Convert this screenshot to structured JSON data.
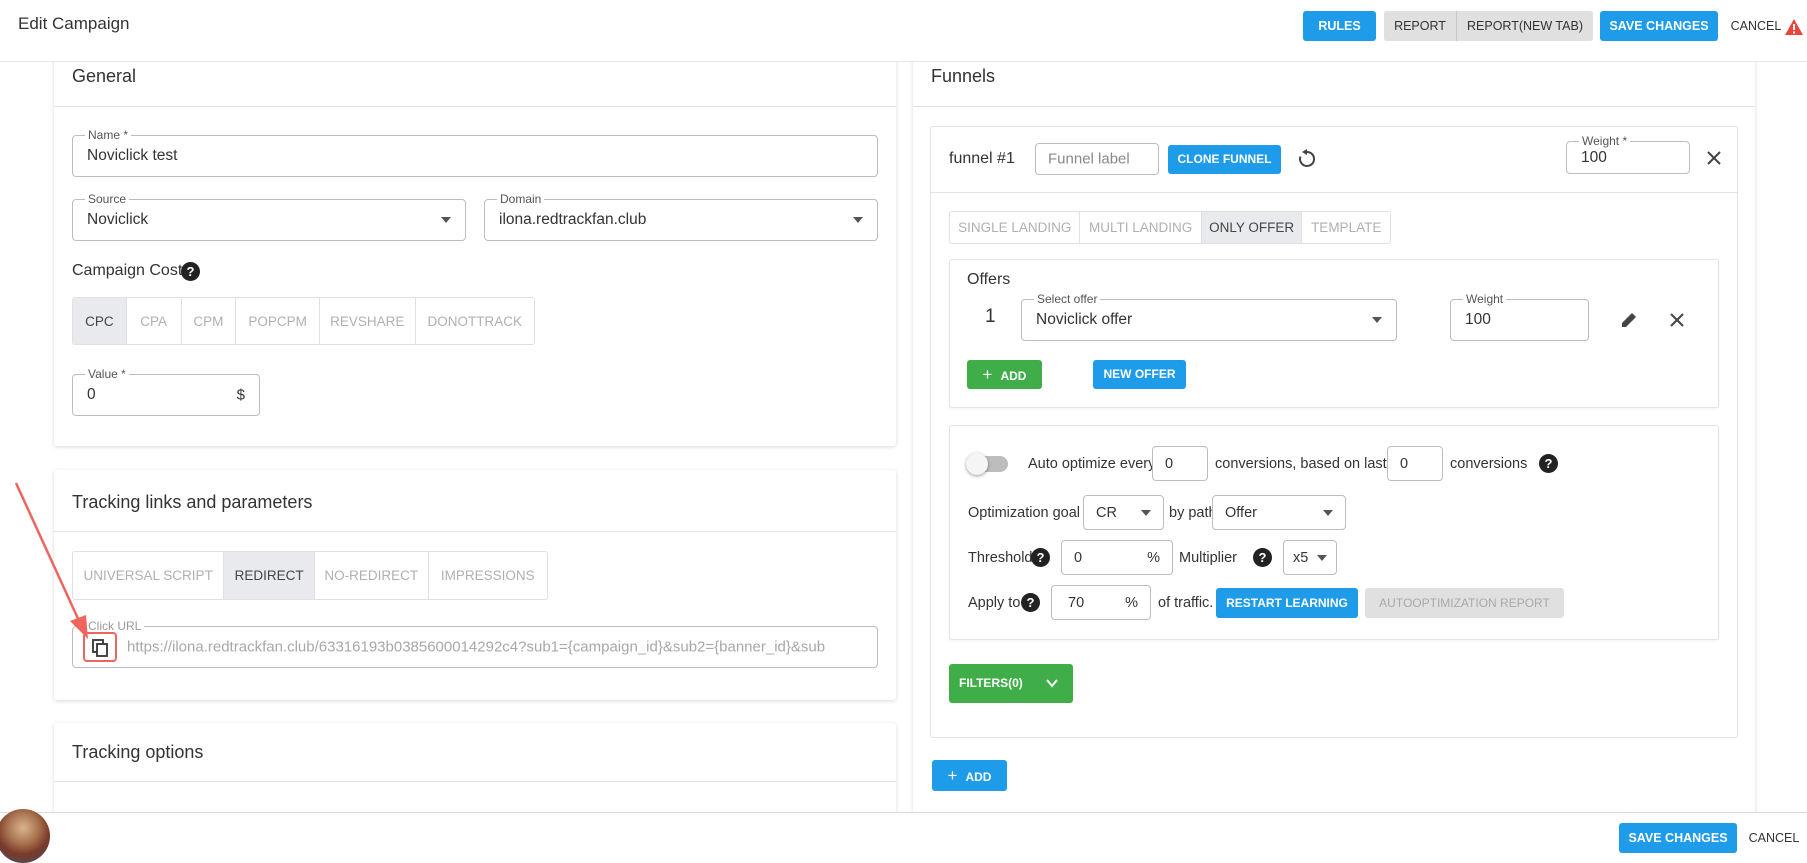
{
  "header": {
    "title": "Edit Campaign",
    "rules_label": "RULES",
    "report_label": "REPORT",
    "report_new_tab_label": "REPORT(NEW TAB)",
    "save_label": "SAVE CHANGES",
    "cancel_label": "CANCEL"
  },
  "general": {
    "title": "General",
    "name_label": "Name *",
    "name_value": "Noviclick test",
    "source_label": "Source",
    "source_value": "Noviclick",
    "domain_label": "Domain",
    "domain_value": "ilona.redtrackfan.club",
    "cost_title": "Campaign Cost",
    "cost_types": [
      "CPC",
      "CPA",
      "CPM",
      "POPCPM",
      "REVSHARE",
      "DONOTTRACK"
    ],
    "cost_selected": "CPC",
    "value_label": "Value *",
    "value_value": "0",
    "value_unit": "$"
  },
  "tracking": {
    "title": "Tracking links and parameters",
    "tabs": [
      "UNIVERSAL SCRIPT",
      "REDIRECT",
      "NO-REDIRECT",
      "IMPRESSIONS"
    ],
    "active_tab": "REDIRECT",
    "click_url_label": "Click URL",
    "click_url_value": "https://ilona.redtrackfan.club/63316193b0385600014292c4?sub1={campaign_id}&sub2={banner_id}&sub"
  },
  "tracking_options": {
    "title": "Tracking options"
  },
  "funnels": {
    "title": "Funnels",
    "funnel_name": "funnel #1",
    "funnel_label_placeholder": "Funnel label",
    "clone_label": "CLONE FUNNEL",
    "weight_label": "Weight *",
    "weight_value": "100",
    "modes": [
      "SINGLE LANDING",
      "MULTI LANDING",
      "ONLY OFFER",
      "TEMPLATE"
    ],
    "active_mode": "ONLY OFFER",
    "offers_title": "Offers",
    "offer_index": "1",
    "select_offer_label": "Select offer",
    "select_offer_value": "Noviclick offer",
    "offer_weight_label": "Weight",
    "offer_weight_value": "100",
    "add_label": "ADD",
    "new_offer_label": "NEW OFFER",
    "auto_optimize_text": "Auto optimize every",
    "auto_optimize_value": "0",
    "conversions_based_text": "conversions, based on last",
    "conversions_value": "0",
    "conversions_text": "conversions",
    "opt_goal_text": "Optimization goal",
    "opt_goal_value": "CR",
    "by_path_text": "by path",
    "by_path_value": "Offer",
    "threshold_text": "Threshold",
    "threshold_value": "0",
    "threshold_unit": "%",
    "multiplier_text": "Multiplier",
    "multiplier_value": "x5",
    "apply_to_text": "Apply to",
    "apply_to_value": "70",
    "apply_to_unit": "%",
    "of_traffic_text": "of traffic.",
    "restart_label": "RESTART LEARNING",
    "autoopt_report_label": "AUTOOPTIMIZATION REPORT",
    "filters_label": "FILTERS(0)",
    "add_funnel_label": "ADD"
  },
  "footer": {
    "save_label": "SAVE CHANGES",
    "cancel_label": "CANCEL"
  },
  "colors": {
    "primary": "#1e9be9",
    "success": "#3fae49",
    "annotation": "#f0645e"
  }
}
